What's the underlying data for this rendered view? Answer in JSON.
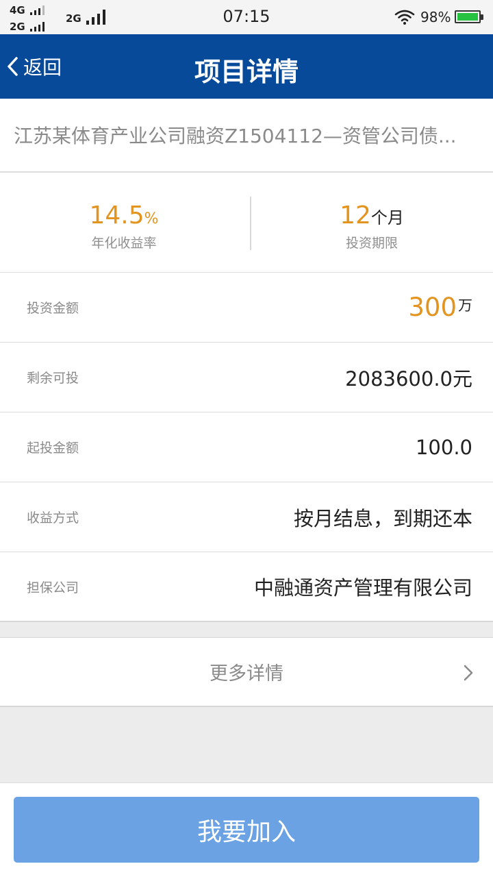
{
  "status_bar": {
    "net1": "4G",
    "net2": "2G",
    "net3": "2G",
    "time": "07:15",
    "wifi_icon": "wifi-icon",
    "battery_percent": "98%",
    "battery_color": "#27c142"
  },
  "nav": {
    "back_label": "返回",
    "title": "项目详情",
    "bg_color": "#074a9a"
  },
  "project": {
    "name": "江苏某体育产业公司融资Z1504112—资管公司债..."
  },
  "metrics": {
    "rate_value": "14.5",
    "rate_unit": "%",
    "rate_label": "年化收益率",
    "term_value": "12",
    "term_unit": "个月",
    "term_label": "投资期限",
    "accent_color": "#e3941f"
  },
  "details": {
    "amount_label": "投资金额",
    "amount_value": "300",
    "amount_unit": "万",
    "remaining_label": "剩余可投",
    "remaining_value": "2083600.0元",
    "min_label": "起投金额",
    "min_value": "100.0",
    "method_label": "收益方式",
    "method_value": "按月结息，到期还本",
    "guarantor_label": "担保公司",
    "guarantor_value": "中融通资产管理有限公司"
  },
  "more": {
    "label": "更多详情",
    "chevron_icon": "chevron-right-icon"
  },
  "action": {
    "join_label": "我要加入",
    "button_color": "#6aa2e4"
  }
}
